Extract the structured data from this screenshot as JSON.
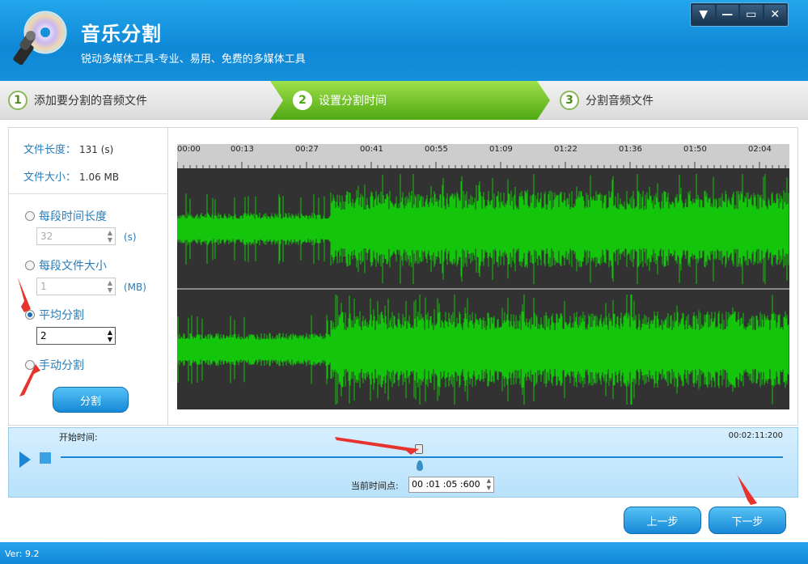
{
  "app": {
    "title": "音乐分割",
    "subtitle": "锐动多媒体工具-专业、易用、免费的多媒体工具"
  },
  "window_controls": {
    "menu": "▼",
    "minimize": "—",
    "maximize": "▭",
    "close": "✕"
  },
  "steps": [
    {
      "num": "1",
      "label": "添加要分割的音频文件"
    },
    {
      "num": "2",
      "label": "设置分割时间"
    },
    {
      "num": "3",
      "label": "分割音频文件"
    }
  ],
  "file_info": {
    "length_label": "文件长度：",
    "length_value": "131 (s)",
    "size_label": "文件大小：",
    "size_value": "1.06 MB"
  },
  "options": {
    "per_time": {
      "label": "每段时间长度",
      "value": "32",
      "unit": "(s)"
    },
    "per_size": {
      "label": "每段文件大小",
      "value": "1",
      "unit": "(MB)"
    },
    "average": {
      "label": "平均分割",
      "value": "2"
    },
    "manual": {
      "label": "手动分割"
    },
    "selected": "average"
  },
  "split_button": "分割",
  "timeline": {
    "labels": [
      "00:00",
      "00:13",
      "00:27",
      "00:41",
      "00:55",
      "01:09",
      "01:22",
      "01:36",
      "01:50",
      "02:04"
    ]
  },
  "playback": {
    "start_label": "开始时间:",
    "total_time": "00:02:11:200",
    "current_label": "当前时间点:",
    "current_value": "00 :01 :05 :600",
    "position_fraction": 0.5
  },
  "nav": {
    "prev": "上一步",
    "next": "下一步"
  },
  "status": {
    "version": "Ver: 9.2"
  },
  "colors": {
    "accent": "#1688d6",
    "wave": "#13c60b",
    "wave_bg": "#323232",
    "step_active": "#5cb81c",
    "annotation": "#e8322d"
  }
}
